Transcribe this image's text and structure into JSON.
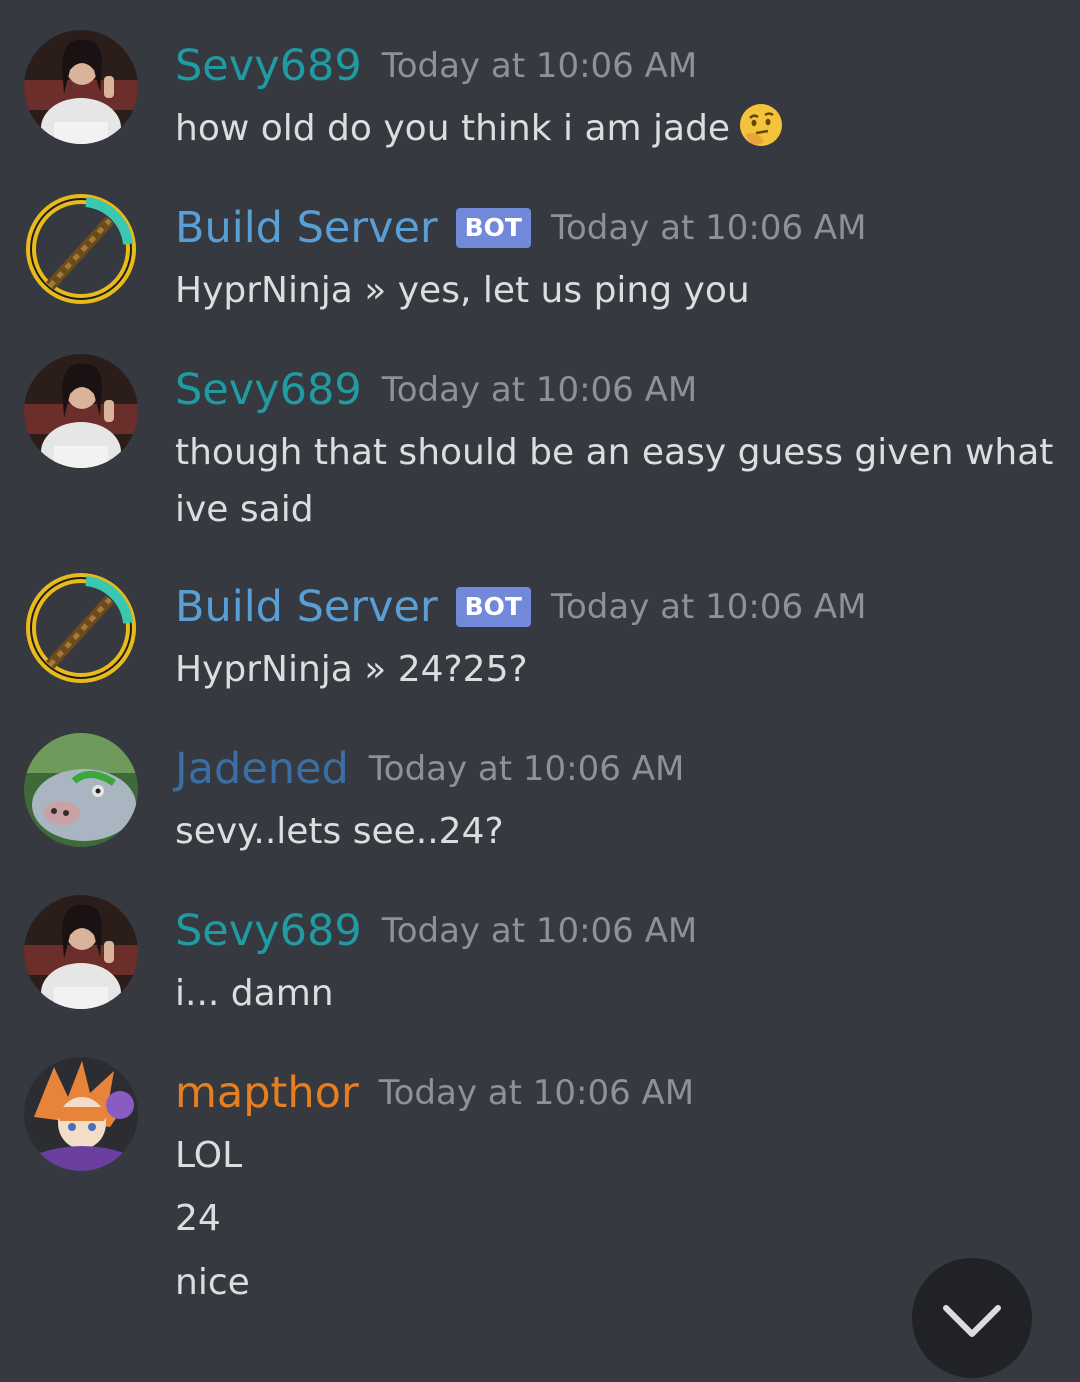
{
  "messages": [
    {
      "author": "Sevy689",
      "author_color": "#1f9ba1",
      "timestamp": "Today at 10:06 AM",
      "lines": [
        "how old do you think i am jade"
      ],
      "emoji": "thinking-face-emoji"
    },
    {
      "author": "Build Server",
      "author_color": "#5a9ed6",
      "badge": "BOT",
      "timestamp": "Today at 10:06 AM",
      "lines": [
        "HyprNinja »  yes, let us ping you"
      ]
    },
    {
      "author": "Sevy689",
      "author_color": "#1f9ba1",
      "timestamp": "Today at 10:06 AM",
      "lines": [
        "though that should be an easy guess given what",
        "ive said"
      ]
    },
    {
      "author": "Build Server",
      "author_color": "#5a9ed6",
      "badge": "BOT",
      "timestamp": "Today at 10:06 AM",
      "lines": [
        "HyprNinja »  24?25?"
      ]
    },
    {
      "author": "Jadened",
      "author_color": "#3b6ea5",
      "timestamp": "Today at 10:06 AM",
      "lines": [
        "sevy..lets see..24?"
      ]
    },
    {
      "author": "Sevy689",
      "author_color": "#1f9ba1",
      "timestamp": "Today at 10:06 AM",
      "lines": [
        "i... damn"
      ]
    },
    {
      "author": "mapthor",
      "author_color": "#e67e22",
      "timestamp": "Today at 10:06 AM",
      "lines": [
        "LOL",
        "24",
        "nice"
      ]
    }
  ],
  "jump_button": {
    "icon": "chevron-down-icon"
  }
}
